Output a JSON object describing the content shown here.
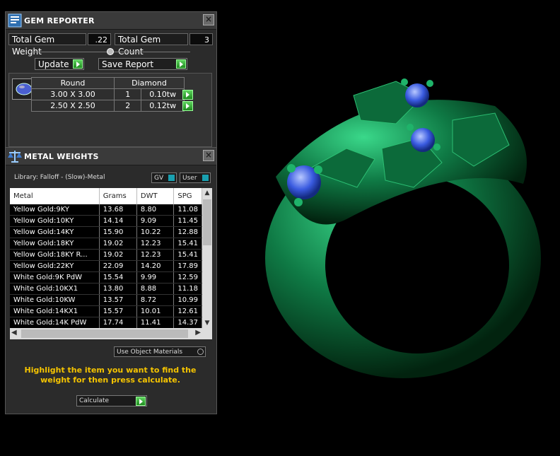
{
  "gem_reporter": {
    "title": "GEM REPORTER",
    "total_weight_label": "Total Gem Weight",
    "total_weight_value": ".22",
    "total_count_label": "Total Gem Count",
    "total_count_value": "3",
    "update_label": "Update",
    "save_label": "Save Report",
    "table_headers": [
      "Round",
      "Diamond"
    ],
    "rows": [
      {
        "size": "3.00 X 3.00",
        "count": "1",
        "weight": "0.10tw"
      },
      {
        "size": "2.50 X 2.50",
        "count": "2",
        "weight": "0.12tw"
      }
    ]
  },
  "metal_weights": {
    "title": "METAL WEIGHTS",
    "library": "Library: Falloff - (Slow)-Metal",
    "gv_label": "GV",
    "user_label": "User",
    "columns": [
      "Metal",
      "Grams",
      "DWT",
      "SPG"
    ],
    "rows": [
      [
        "Yellow Gold:9KY",
        "13.68",
        "8.80",
        "11.08"
      ],
      [
        "Yellow Gold:10KY",
        "14.14",
        "9.09",
        "11.45"
      ],
      [
        "Yellow Gold:14KY",
        "15.90",
        "10.22",
        "12.88"
      ],
      [
        "Yellow Gold:18KY",
        "19.02",
        "12.23",
        "15.41"
      ],
      [
        "Yellow Gold:18KY R...",
        "19.02",
        "12.23",
        "15.41"
      ],
      [
        "Yellow Gold:22KY",
        "22.09",
        "14.20",
        "17.89"
      ],
      [
        "White Gold:9K PdW",
        "15.54",
        "9.99",
        "12.59"
      ],
      [
        "White Gold:10KX1",
        "13.80",
        "8.88",
        "11.18"
      ],
      [
        "White Gold:10KW",
        "13.57",
        "8.72",
        "10.99"
      ],
      [
        "White Gold:14KX1",
        "15.57",
        "10.01",
        "12.61"
      ],
      [
        "White Gold:14K PdW",
        "17.74",
        "11.41",
        "14.37"
      ]
    ],
    "use_object_materials": "Use Object Materials",
    "hint": "Highlight the item you want to find the weight for then press calculate.",
    "calculate_label": "Calculate"
  },
  "colors": {
    "ring": "#0f7a45",
    "gem": "#3a5be0",
    "hint": "#f5c400"
  }
}
